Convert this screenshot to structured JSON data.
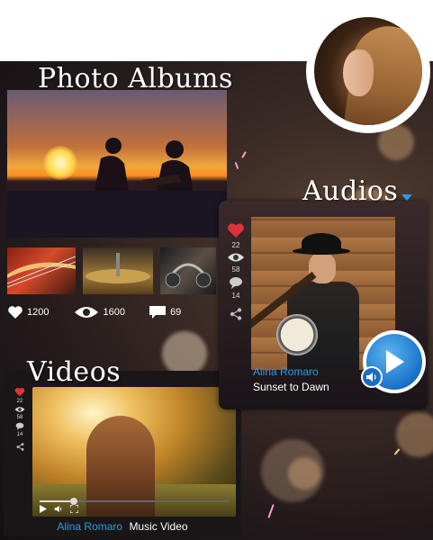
{
  "photo_albums": {
    "title": "Photo Albums",
    "stats": {
      "likes": "1200",
      "views": "1600",
      "comments": "69"
    }
  },
  "audios": {
    "title": "Audios",
    "stats": {
      "likes": "22",
      "views": "58",
      "comments": "14"
    },
    "artist": "Alina Romaro",
    "song": "Sunset to Dawn"
  },
  "videos": {
    "title": "Videos",
    "stats": {
      "likes": "22",
      "views": "58",
      "comments": "14"
    },
    "artist": "Alina Romaro",
    "title_text": "Music Video",
    "progress_fraction": 0.18
  },
  "colors": {
    "accent": "#2b9be0",
    "like": "#e0303a"
  }
}
